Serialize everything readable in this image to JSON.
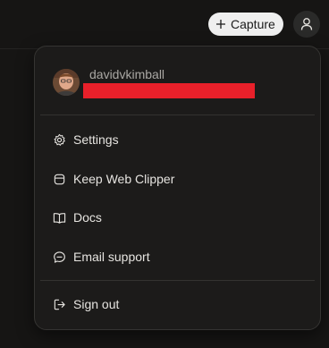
{
  "topbar": {
    "capture_label": "Capture"
  },
  "menu": {
    "username": "davidvkimball",
    "items": [
      {
        "label": "Settings",
        "icon": "gear-icon"
      },
      {
        "label": "Keep Web Clipper",
        "icon": "clipper-icon"
      },
      {
        "label": "Docs",
        "icon": "book-icon"
      },
      {
        "label": "Email support",
        "icon": "chat-icon"
      }
    ],
    "sign_out_label": "Sign out"
  },
  "colors": {
    "redaction": "#e8202a",
    "menu_bg": "#1c1b1a",
    "page_bg": "#161514"
  }
}
